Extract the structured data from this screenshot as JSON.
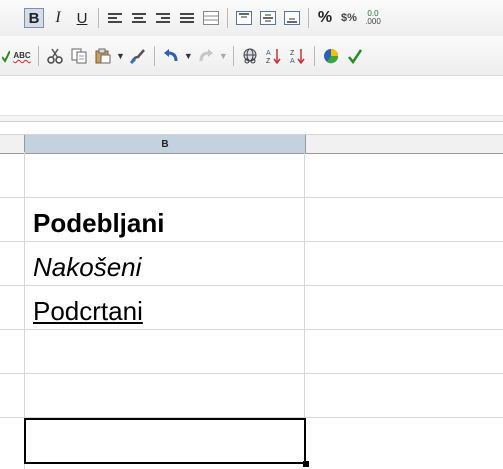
{
  "toolbar1": {
    "bold_label": "B",
    "italic_label": "I",
    "underline_label": "U",
    "percent_label": "%",
    "currency_label": "$%",
    "decimal_top": "0.0",
    "decimal_bottom": ".000"
  },
  "toolbar2": {
    "spellcheck_label": "ABC"
  },
  "spreadsheet": {
    "column_b_header": "B",
    "cells": [
      "",
      "Podebljani",
      "Nakošeni",
      "Podcrtani",
      "",
      "",
      ""
    ]
  },
  "colors": {
    "selected_column_header": "#c4d1de",
    "bold_button_active": "#d7dde8"
  }
}
